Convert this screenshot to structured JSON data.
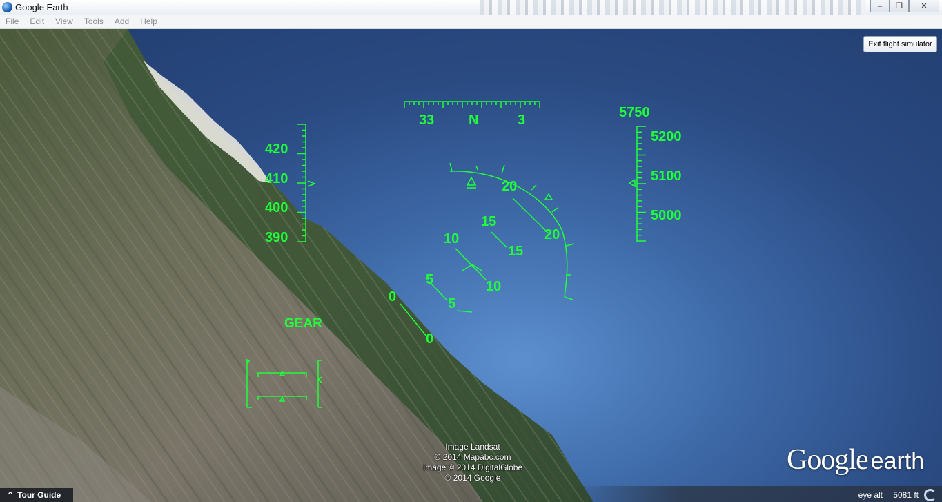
{
  "window": {
    "title": "Google Earth",
    "controls": {
      "minimize": "‒",
      "maximize": "❐",
      "close": "✕"
    }
  },
  "menu": [
    "File",
    "Edit",
    "View",
    "Tools",
    "Add",
    "Help"
  ],
  "exit_button": "Exit flight simulator",
  "hud": {
    "heading_labels": [
      "33",
      "N",
      "3"
    ],
    "speed_labels": [
      "420",
      "410",
      "400",
      "390"
    ],
    "altitude_top": "5750",
    "altitude_labels": [
      "5200",
      "5100",
      "5000"
    ],
    "pitch_left_labels": [
      "20",
      "15",
      "10",
      "5",
      "0"
    ],
    "pitch_right_labels": [
      "20",
      "15",
      "10",
      "5",
      "0"
    ],
    "gear": "GEAR",
    "color": "#20ff3a"
  },
  "attribution": [
    "Image Landsat",
    "© 2014 Mapabc.com",
    "Image © 2014 DigitalGlobe",
    "© 2014 Google"
  ],
  "logo": {
    "google": "Google",
    "earth": "earth"
  },
  "status": {
    "tour_guide": "Tour Guide",
    "tour_icon": "chevron-up-icon",
    "eye_alt_label": "eye alt",
    "eye_alt_value": "5081 ft"
  }
}
